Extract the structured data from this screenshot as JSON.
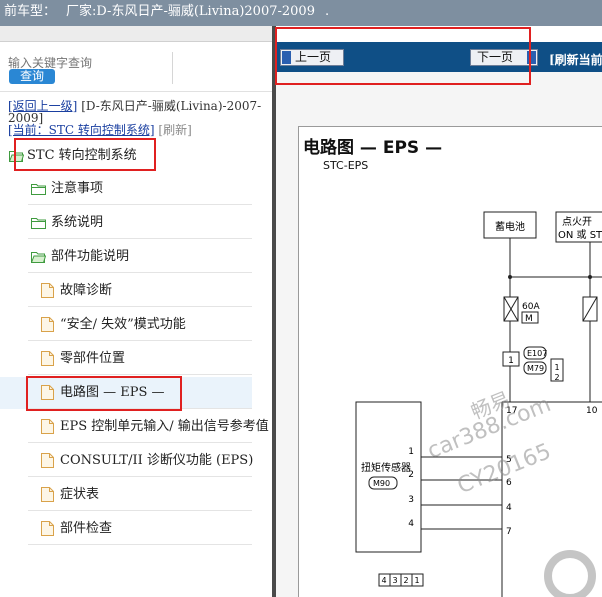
{
  "topbar": {
    "label": "前车型：",
    "value": "厂家:D-东风日产-骊威(Livina)2007-2009",
    "tail": "."
  },
  "search": {
    "placeholder": "输入关键字查询",
    "button": "查询"
  },
  "breadcrumb": {
    "back_link": "[返回上一级]",
    "back_text": "[D-东风日产-骊威(Livina)-2007-2009]",
    "current_link": "[当前：STC 转向控制系统]",
    "refresh": "[刷新]"
  },
  "tree": [
    {
      "label": "STC 转向控制系统",
      "icon": "folder-open-icon"
    },
    {
      "label": "注意事项",
      "icon": "folder-icon"
    },
    {
      "label": "系统说明",
      "icon": "folder-icon"
    },
    {
      "label": "部件功能说明",
      "icon": "folder-open-icon"
    },
    {
      "label": "故障诊断",
      "icon": "document-icon"
    },
    {
      "label": "“安全/ 失效”模式功能",
      "icon": "document-icon"
    },
    {
      "label": "零部件位置",
      "icon": "document-icon"
    },
    {
      "label": "电路图 — EPS —",
      "icon": "document-icon",
      "selected": true
    },
    {
      "label": "EPS 控制单元输入/ 输出信号参考值",
      "icon": "document-icon"
    },
    {
      "label": "CONSULT/II 诊断仪功能 (EPS)",
      "icon": "document-icon"
    },
    {
      "label": "症状表",
      "icon": "document-icon"
    },
    {
      "label": "部件检查",
      "icon": "document-icon"
    }
  ],
  "nav": {
    "prev": "上一页",
    "next": "下一页",
    "refresh": "[刷新当前]"
  },
  "diagram": {
    "title": "电路图 — EPS —",
    "subtitle": "STC-EPS",
    "battery": "蓄电池",
    "ignition": "点火开",
    "ignition_line2": "ON 或 ST",
    "fuse_rating": "60A",
    "fuse_letter": "M",
    "conn_e107": "E107",
    "conn_m79": "M79",
    "pin_1": "1",
    "pin_2": "2",
    "pin_17": "17",
    "pin_10": "10",
    "sensor_name": "扭矩传感器",
    "sensor_conn": "M90",
    "sensor_pins": [
      "1",
      "2",
      "3",
      "4"
    ],
    "ecu_pins": [
      "5",
      "6",
      "4",
      "7"
    ],
    "bottom_pins": [
      "4",
      "3",
      "2",
      "1"
    ]
  },
  "watermark": {
    "line1": "畅易",
    "line2": "car388.com",
    "line3": "CY20165"
  },
  "colors": {
    "topbar": "#7e8fa0",
    "navbar": "#0f4f86",
    "highlight": "#e02020",
    "search_btn": "#2a87d4"
  }
}
